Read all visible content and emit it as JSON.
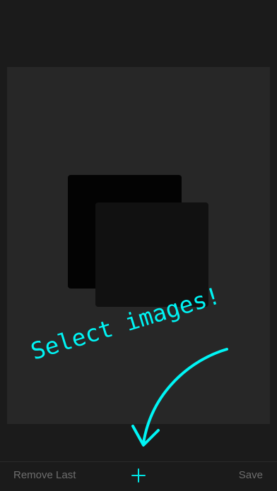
{
  "hint": {
    "text": "Select images!",
    "color": "#00f5f5"
  },
  "toolbar": {
    "remove_label": "Remove Last",
    "add_icon": "plus-icon",
    "save_label": "Save",
    "button_color": "#6e6e6e",
    "accent_color": "#00e5e5"
  }
}
